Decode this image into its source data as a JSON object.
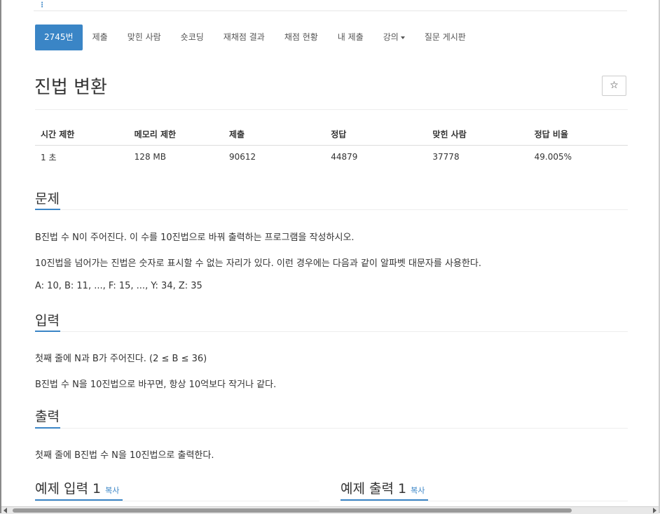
{
  "nav": {
    "tabs": [
      {
        "label": "2745번",
        "active": true
      },
      {
        "label": "제출"
      },
      {
        "label": "맞힌 사람"
      },
      {
        "label": "숏코딩"
      },
      {
        "label": "재채점 결과"
      },
      {
        "label": "채점 현황"
      },
      {
        "label": "내 제출"
      },
      {
        "label": "강의",
        "dropdown": true
      },
      {
        "label": "질문 게시판"
      }
    ]
  },
  "problem": {
    "title": "진법 변환",
    "star_icon": "☆",
    "info_headers": [
      "시간 제한",
      "메모리 제한",
      "제출",
      "정답",
      "맞힌 사람",
      "정답 비율"
    ],
    "info_values": [
      "1 초",
      "128 MB",
      "90612",
      "44879",
      "37778",
      "49.005%"
    ]
  },
  "sections": {
    "description": {
      "heading": "문제",
      "paragraphs": [
        "B진법 수 N이 주어진다. 이 수를 10진법으로 바꿔 출력하는 프로그램을 작성하시오.",
        "10진법을 넘어가는 진법은 숫자로 표시할 수 없는 자리가 있다. 이런 경우에는 다음과 같이 알파벳 대문자를 사용한다.",
        "A: 10, B: 11, ..., F: 15, ..., Y: 34, Z: 35"
      ]
    },
    "input": {
      "heading": "입력",
      "paragraphs": [
        "첫째 줄에 N과 B가 주어진다. (2 ≤ B ≤ 36)",
        "B진법 수 N을 10진법으로 바꾸면, 항상 10억보다 작거나 같다."
      ]
    },
    "output": {
      "heading": "출력",
      "paragraphs": [
        "첫째 줄에 B진법 수 N을 10진법으로 출력한다."
      ]
    },
    "sample_input": {
      "heading": "예제 입력 1",
      "copy_label": "복사"
    },
    "sample_output": {
      "heading": "예제 출력 1",
      "copy_label": "복사"
    }
  },
  "colors": {
    "accent": "#3a85c6"
  }
}
